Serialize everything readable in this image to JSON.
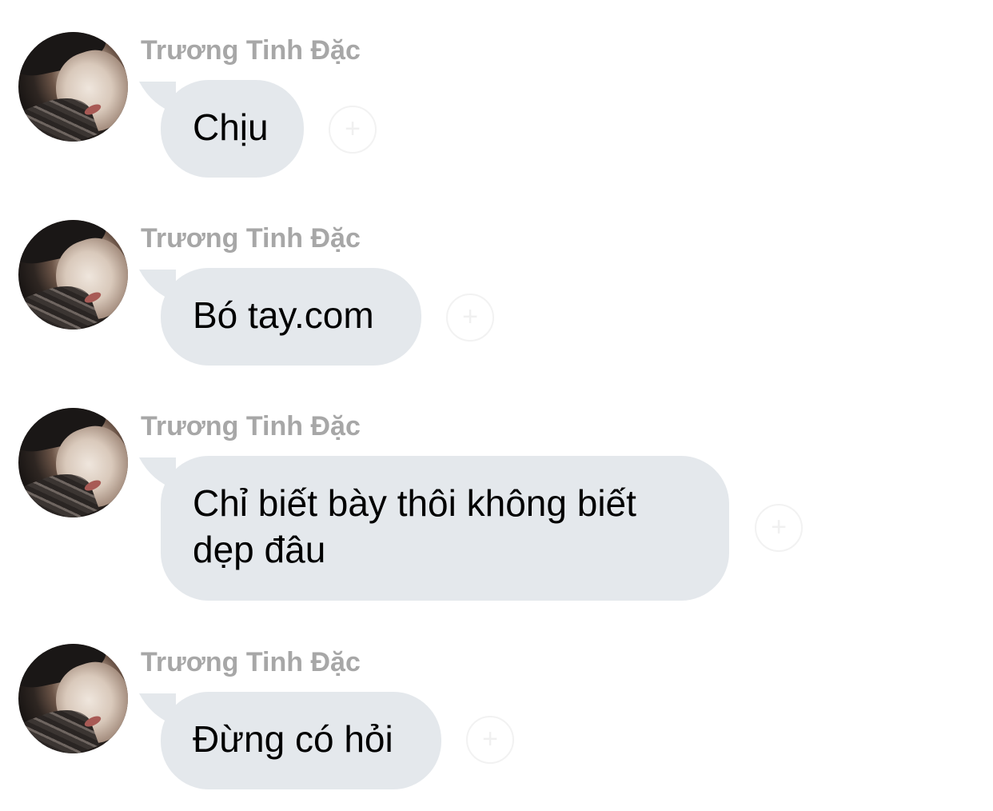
{
  "messages": [
    {
      "sender": "Trương Tinh Đặc",
      "text": "Chịu",
      "avatar_icon": "user-avatar-photo",
      "reaction_icon": "add-reaction-icon"
    },
    {
      "sender": "Trương Tinh Đặc",
      "text": "Bó tay.com",
      "avatar_icon": "user-avatar-photo",
      "reaction_icon": "add-reaction-icon"
    },
    {
      "sender": "Trương Tinh Đặc",
      "text": "Chỉ biết bày thôi không biết dẹp đâu",
      "avatar_icon": "user-avatar-photo",
      "reaction_icon": "add-reaction-icon"
    },
    {
      "sender": "Trương Tinh Đặc",
      "text": "Đừng có hỏi",
      "avatar_icon": "user-avatar-photo",
      "reaction_icon": "add-reaction-icon"
    }
  ],
  "colors": {
    "bubble": "#e4e8ec",
    "sender_name": "#a7a7a7",
    "text": "#000000",
    "background": "#ffffff"
  }
}
